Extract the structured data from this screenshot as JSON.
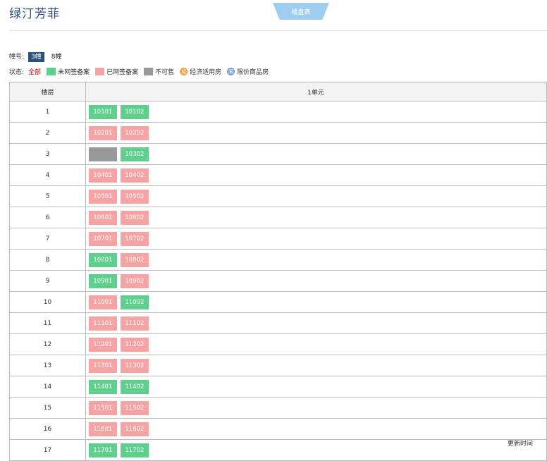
{
  "page": {
    "title": "绿汀芳菲",
    "tab_label": "楼盘表",
    "building_label": "幢号:",
    "buildings": [
      {
        "label": "3幢",
        "active": true
      },
      {
        "label": "8幢",
        "active": false
      }
    ],
    "status_label": "状态:",
    "status_all": "全部",
    "legend": [
      {
        "label": "未网签备案",
        "color": "#5fcf8e",
        "shape": "square"
      },
      {
        "label": "已网签备案",
        "color": "#f5a3a3",
        "shape": "square"
      },
      {
        "label": "不可售",
        "color": "#999999",
        "shape": "square"
      },
      {
        "label": "经济适用房",
        "color": "#f0a040",
        "shape": "circle",
        "glyph": "经"
      },
      {
        "label": "限价商品房",
        "color": "#7a9bd0",
        "shape": "circle",
        "glyph": "限"
      }
    ],
    "table": {
      "col_floor": "楼层",
      "col_unit": "1单元",
      "rows": [
        {
          "floor": "1",
          "rooms": [
            {
              "no": "10101",
              "status": "green"
            },
            {
              "no": "10102",
              "status": "green"
            }
          ]
        },
        {
          "floor": "2",
          "rooms": [
            {
              "no": "10201",
              "status": "pink"
            },
            {
              "no": "10202",
              "status": "pink"
            }
          ]
        },
        {
          "floor": "3",
          "rooms": [
            {
              "no": "",
              "status": "gray"
            },
            {
              "no": "10302",
              "status": "green"
            }
          ]
        },
        {
          "floor": "4",
          "rooms": [
            {
              "no": "10401",
              "status": "pink"
            },
            {
              "no": "10402",
              "status": "pink"
            }
          ]
        },
        {
          "floor": "5",
          "rooms": [
            {
              "no": "10501",
              "status": "pink"
            },
            {
              "no": "10502",
              "status": "pink"
            }
          ]
        },
        {
          "floor": "6",
          "rooms": [
            {
              "no": "10601",
              "status": "pink"
            },
            {
              "no": "10602",
              "status": "pink"
            }
          ]
        },
        {
          "floor": "7",
          "rooms": [
            {
              "no": "10701",
              "status": "pink"
            },
            {
              "no": "10702",
              "status": "pink"
            }
          ]
        },
        {
          "floor": "8",
          "rooms": [
            {
              "no": "10801",
              "status": "green"
            },
            {
              "no": "10802",
              "status": "pink"
            }
          ]
        },
        {
          "floor": "9",
          "rooms": [
            {
              "no": "10901",
              "status": "green"
            },
            {
              "no": "10902",
              "status": "pink"
            }
          ]
        },
        {
          "floor": "10",
          "rooms": [
            {
              "no": "11001",
              "status": "pink"
            },
            {
              "no": "11002",
              "status": "green"
            }
          ]
        },
        {
          "floor": "11",
          "rooms": [
            {
              "no": "11101",
              "status": "pink"
            },
            {
              "no": "11102",
              "status": "pink"
            }
          ]
        },
        {
          "floor": "12",
          "rooms": [
            {
              "no": "11201",
              "status": "pink"
            },
            {
              "no": "11202",
              "status": "pink"
            }
          ]
        },
        {
          "floor": "13",
          "rooms": [
            {
              "no": "11301",
              "status": "pink"
            },
            {
              "no": "11302",
              "status": "pink"
            }
          ]
        },
        {
          "floor": "14",
          "rooms": [
            {
              "no": "11401",
              "status": "green"
            },
            {
              "no": "11402",
              "status": "green"
            }
          ]
        },
        {
          "floor": "15",
          "rooms": [
            {
              "no": "11501",
              "status": "pink"
            },
            {
              "no": "11502",
              "status": "pink"
            }
          ]
        },
        {
          "floor": "16",
          "rooms": [
            {
              "no": "11601",
              "status": "pink"
            },
            {
              "no": "11602",
              "status": "pink"
            }
          ]
        },
        {
          "floor": "17",
          "rooms": [
            {
              "no": "11701",
              "status": "green"
            },
            {
              "no": "11702",
              "status": "green"
            }
          ]
        }
      ]
    },
    "footer_text": "更新时间"
  }
}
